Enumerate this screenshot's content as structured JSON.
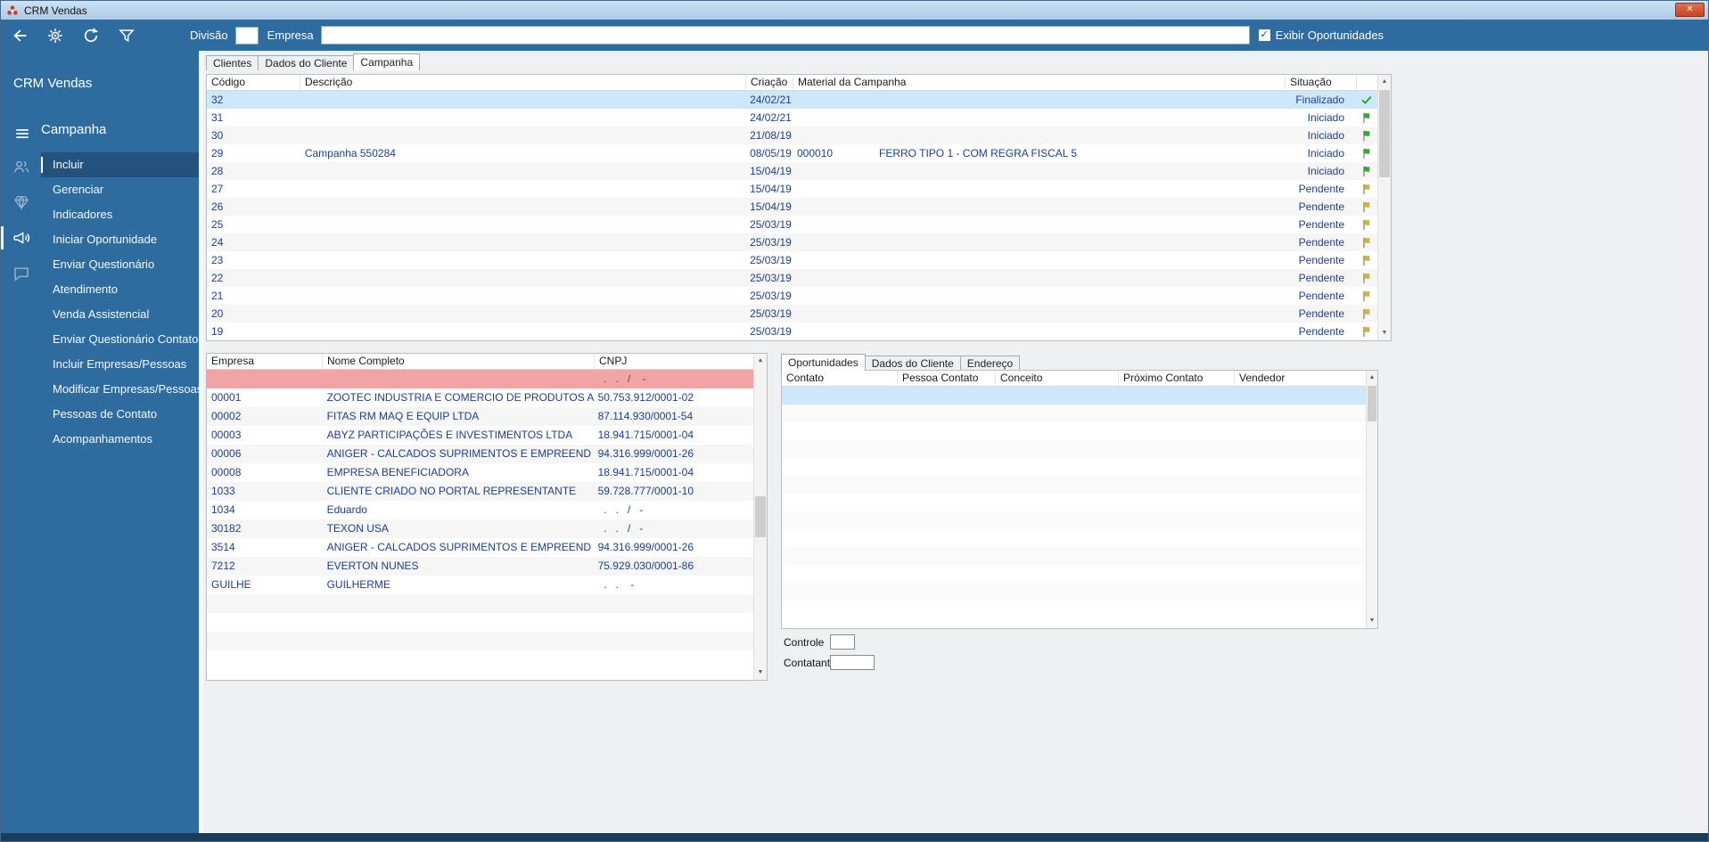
{
  "window": {
    "title": "CRM Vendas",
    "close_glyph": "✕"
  },
  "scrollbar": {
    "up_glyph": "▲",
    "down_glyph": "▼"
  },
  "toolbar": {
    "icons": [
      "back-icon",
      "settings-icon",
      "refresh-icon",
      "filter-icon"
    ],
    "divisao_label": "Divisão",
    "divisao_value": "",
    "empresa_label": "Empresa",
    "empresa_value": "",
    "exibir_oportunidades_label": "Exibir Oportunidades",
    "exibir_checked": true,
    "check_glyph": "✓"
  },
  "sidebar": {
    "app_title": "CRM Vendas",
    "menu_icon": "menu-icon",
    "section_title": "Campanha",
    "rail_icons": [
      {
        "name": "people-icon"
      },
      {
        "name": "gem-icon"
      },
      {
        "name": "megaphone-icon",
        "active": true
      },
      {
        "name": "chat-icon"
      }
    ],
    "items": [
      "Incluir",
      "Gerenciar",
      "Indicadores",
      "Iniciar Oportunidade",
      "Enviar Questionário",
      "Atendimento",
      "Venda Assistencial",
      "Enviar Questionário Contato",
      "Incluir Empresas/Pessoas",
      "Modificar Empresas/Pessoas",
      "Pessoas de Contato",
      "Acompanhamentos"
    ],
    "selected_item": "Incluir"
  },
  "tabs_main": {
    "items": [
      "Clientes",
      "Dados do Cliente",
      "Campanha"
    ],
    "active": "Campanha"
  },
  "campaign_grid": {
    "columns": [
      "Código",
      "Descrição",
      "Criação",
      "Material da Campanha",
      "Situação"
    ],
    "rows": [
      {
        "codigo": "32",
        "descricao": "",
        "criacao": "24/02/21",
        "material_codigo": "",
        "material_descricao": "",
        "situacao": "Finalizado",
        "status_icon": "check-green",
        "selected": true
      },
      {
        "codigo": "31",
        "descricao": "",
        "criacao": "24/02/21",
        "material_codigo": "",
        "material_descricao": "",
        "situacao": "Iniciado",
        "status_icon": "flag-green"
      },
      {
        "codigo": "30",
        "descricao": "",
        "criacao": "21/08/19",
        "material_codigo": "",
        "material_descricao": "",
        "situacao": "Iniciado",
        "status_icon": "flag-green"
      },
      {
        "codigo": "29",
        "descricao": "Campanha 550284",
        "criacao": "08/05/19",
        "material_codigo": "000010",
        "material_descricao": "FERRO TIPO 1 - COM REGRA FISCAL 5",
        "situacao": "Iniciado",
        "status_icon": "flag-green"
      },
      {
        "codigo": "28",
        "descricao": "",
        "criacao": "15/04/19",
        "material_codigo": "",
        "material_descricao": "",
        "situacao": "Iniciado",
        "status_icon": "flag-green"
      },
      {
        "codigo": "27",
        "descricao": "",
        "criacao": "15/04/19",
        "material_codigo": "",
        "material_descricao": "",
        "situacao": "Pendente",
        "status_icon": "flag-yellow"
      },
      {
        "codigo": "26",
        "descricao": "",
        "criacao": "15/04/19",
        "material_codigo": "",
        "material_descricao": "",
        "situacao": "Pendente",
        "status_icon": "flag-yellow"
      },
      {
        "codigo": "25",
        "descricao": "",
        "criacao": "25/03/19",
        "material_codigo": "",
        "material_descricao": "",
        "situacao": "Pendente",
        "status_icon": "flag-yellow"
      },
      {
        "codigo": "24",
        "descricao": "",
        "criacao": "25/03/19",
        "material_codigo": "",
        "material_descricao": "",
        "situacao": "Pendente",
        "status_icon": "flag-yellow"
      },
      {
        "codigo": "23",
        "descricao": "",
        "criacao": "25/03/19",
        "material_codigo": "",
        "material_descricao": "",
        "situacao": "Pendente",
        "status_icon": "flag-yellow"
      },
      {
        "codigo": "22",
        "descricao": "",
        "criacao": "25/03/19",
        "material_codigo": "",
        "material_descricao": "",
        "situacao": "Pendente",
        "status_icon": "flag-yellow"
      },
      {
        "codigo": "21",
        "descricao": "",
        "criacao": "25/03/19",
        "material_codigo": "",
        "material_descricao": "",
        "situacao": "Pendente",
        "status_icon": "flag-yellow"
      },
      {
        "codigo": "20",
        "descricao": "",
        "criacao": "25/03/19",
        "material_codigo": "",
        "material_descricao": "",
        "situacao": "Pendente",
        "status_icon": "flag-yellow"
      },
      {
        "codigo": "19",
        "descricao": "",
        "criacao": "25/03/19",
        "material_codigo": "",
        "material_descricao": "",
        "situacao": "Pendente",
        "status_icon": "flag-yellow"
      }
    ]
  },
  "empresa_grid": {
    "columns": [
      "Empresa",
      "Nome Completo",
      "CNPJ"
    ],
    "filter_row": {
      "empresa": "",
      "nome": "",
      "cnpj": "  .   .   /    -"
    },
    "rows": [
      {
        "empresa": "00001",
        "nome": "ZOOTEC INDUSTRIA E COMERCIO DE PRODUTOS AGROPECUÁ",
        "cnpj": "50.753.912/0001-02"
      },
      {
        "empresa": "00002",
        "nome": "FITAS RM MAQ E EQUIP LTDA",
        "cnpj": "87.114.930/0001-54"
      },
      {
        "empresa": "00003",
        "nome": "ABYZ PARTICIPAÇÕES E INVESTIMENTOS LTDA",
        "cnpj": "18.941.715/0001-04"
      },
      {
        "empresa": "00006",
        "nome": "ANIGER - CALCADOS SUPRIMENTOS E EMPREEND LTDA",
        "cnpj": "94.316.999/0001-26"
      },
      {
        "empresa": "00008",
        "nome": "EMPRESA BENEFICIADORA",
        "cnpj": "18.941.715/0001-04"
      },
      {
        "empresa": "1033",
        "nome": "CLIENTE CRIADO NO PORTAL REPRESENTANTE",
        "cnpj": "59.728.777/0001-10"
      },
      {
        "empresa": "1034",
        "nome": "Eduardo",
        "cnpj": "  .   .   /   -"
      },
      {
        "empresa": "30182",
        "nome": "TEXON USA",
        "cnpj": "  .   .   /   -"
      },
      {
        "empresa": "3514",
        "nome": "ANIGER - CALCADOS SUPRIMENTOS E EMPREEND LTDA",
        "cnpj": "94.316.999/0001-26"
      },
      {
        "empresa": "7212",
        "nome": "EVERTON NUNES",
        "cnpj": "75.929.030/0001-86"
      },
      {
        "empresa": "GUILHE",
        "nome": "GUILHERME",
        "cnpj": "  .   .    -"
      }
    ]
  },
  "right_panel": {
    "tabs": [
      "Oportunidades",
      "Dados do Cliente",
      "Endereço"
    ],
    "active_tab": "Oportunidades",
    "grid_columns": [
      "Contato",
      "Pessoa Contato",
      "Conceito",
      "Próximo Contato",
      "Vendedor"
    ],
    "controle_label": "Controle",
    "controle_value": "",
    "contatante_label": "Contatante",
    "contatante_value": ""
  },
  "colors": {
    "accent_blue": "#2e6b9f",
    "titlebar_blue": "#b8d4ee",
    "selected_row": "#cfe7fa",
    "invalid_row_pink": "#f2a3a3",
    "grid_text_navy": "#1c3e91",
    "close_button_red": "#d2512e",
    "status_finalizado_green": "#2ca339",
    "flag_iniciado_green": "#3fa43f",
    "flag_pendente_yellow": "#cdb63d"
  }
}
